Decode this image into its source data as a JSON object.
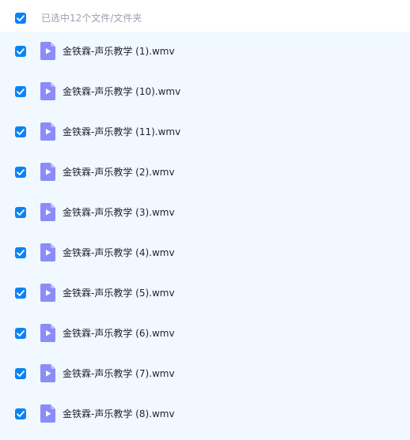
{
  "header": {
    "selection_text": "已选中12个文件/文件夹",
    "all_checked": true
  },
  "files": [
    {
      "name": "金铁霖-声乐教学 (1).wmv",
      "checked": true,
      "icon": "video-file-icon"
    },
    {
      "name": "金铁霖-声乐教学 (10).wmv",
      "checked": true,
      "icon": "video-file-icon"
    },
    {
      "name": "金铁霖-声乐教学 (11).wmv",
      "checked": true,
      "icon": "video-file-icon"
    },
    {
      "name": "金铁霖-声乐教学 (2).wmv",
      "checked": true,
      "icon": "video-file-icon"
    },
    {
      "name": "金铁霖-声乐教学 (3).wmv",
      "checked": true,
      "icon": "video-file-icon"
    },
    {
      "name": "金铁霖-声乐教学 (4).wmv",
      "checked": true,
      "icon": "video-file-icon"
    },
    {
      "name": "金铁霖-声乐教学 (5).wmv",
      "checked": true,
      "icon": "video-file-icon"
    },
    {
      "name": "金铁霖-声乐教学 (6).wmv",
      "checked": true,
      "icon": "video-file-icon"
    },
    {
      "name": "金铁霖-声乐教学 (7).wmv",
      "checked": true,
      "icon": "video-file-icon"
    },
    {
      "name": "金铁霖-声乐教学 (8).wmv",
      "checked": true,
      "icon": "video-file-icon"
    }
  ],
  "colors": {
    "accent": "#0a84f5",
    "list_background": "#f1f8ff",
    "icon_primary": "#8b8cf8",
    "icon_fold": "#b7b8fb"
  }
}
